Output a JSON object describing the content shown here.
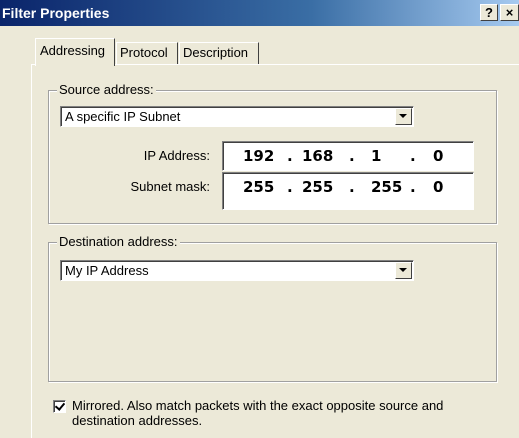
{
  "window": {
    "title": "Filter Properties",
    "help_label": "?",
    "close_label": "×"
  },
  "tabs": [
    {
      "label": "Addressing",
      "active": true
    },
    {
      "label": "Protocol",
      "active": false
    },
    {
      "label": "Description",
      "active": false
    }
  ],
  "source": {
    "group_label": "Source address:",
    "selected": "A specific IP Subnet",
    "ip_label": "IP Address:",
    "ip": [
      "192",
      "168",
      "1",
      "0"
    ],
    "mask_label": "Subnet mask:",
    "mask": [
      "255",
      "255",
      "255",
      "0"
    ]
  },
  "destination": {
    "group_label": "Destination address:",
    "selected": "My IP Address"
  },
  "mirrored": {
    "checked": true,
    "label": "Mirrored. Also match packets with the exact opposite source and destination addresses."
  },
  "ip_separator": "."
}
